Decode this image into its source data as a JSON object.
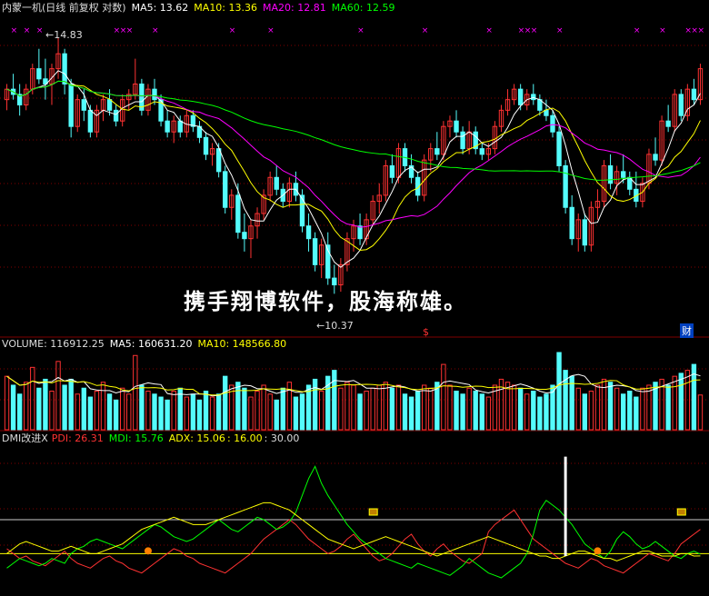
{
  "header": {
    "stock": "内蒙一机(日线 前复权 对数)",
    "ma5": "MA5: 13.62",
    "ma10": "MA10: 13.36",
    "ma20": "MA20: 12.81",
    "ma60": "MA60: 12.59"
  },
  "price_high_label": "14.83",
  "price_low_label": "10.37",
  "overlay_text": "携手翔博软件，股海称雄。",
  "volume_header": {
    "volume": "VOLUME: 116912.25",
    "ma5": "MA5: 160631.20",
    "ma10": "MA10: 148566.80"
  },
  "dmi_header": {
    "name": "DMI改进X",
    "pdi": "PDI: 26.31",
    "mdi": "MDI: 15.76",
    "adx": "ADX: 15.06",
    "level1": ": 16.00",
    "level2": ": 30.00"
  },
  "markers": {
    "dollar": "$",
    "cai": "财"
  },
  "colors": {
    "up": "#ff3232",
    "down": "#54fcfc",
    "ma5": "#ffffff",
    "ma10": "#ffff00",
    "ma20": "#ff00ff",
    "ma60": "#00ff00",
    "grid": "#800000",
    "pdi": "#ff3232",
    "mdi": "#00ff00",
    "adx": "#ffff00"
  },
  "chart_data": [
    {
      "type": "candlestick",
      "title": "内蒙一机(日线 前复权 对数)",
      "price_range": [
        10.0,
        15.2
      ],
      "high_mark": 14.83,
      "low_mark": 10.37,
      "ohlc": [
        [
          13.6,
          13.9,
          13.4,
          13.8
        ],
        [
          13.8,
          14.1,
          13.6,
          13.7
        ],
        [
          13.7,
          13.9,
          13.3,
          13.5
        ],
        [
          13.5,
          13.9,
          13.4,
          13.8
        ],
        [
          13.8,
          14.3,
          13.7,
          14.2
        ],
        [
          14.2,
          14.6,
          13.9,
          14.0
        ],
        [
          14.0,
          14.4,
          13.6,
          13.9
        ],
        [
          13.9,
          14.3,
          13.5,
          14.2
        ],
        [
          14.2,
          14.83,
          14.0,
          14.5
        ],
        [
          14.5,
          14.6,
          13.7,
          13.9
        ],
        [
          13.9,
          14.0,
          12.9,
          13.1
        ],
        [
          13.1,
          13.7,
          13.0,
          13.6
        ],
        [
          13.6,
          13.8,
          13.2,
          13.4
        ],
        [
          13.4,
          13.5,
          12.9,
          13.0
        ],
        [
          13.0,
          13.5,
          12.9,
          13.4
        ],
        [
          13.4,
          13.7,
          13.2,
          13.6
        ],
        [
          13.6,
          13.8,
          13.3,
          13.4
        ],
        [
          13.4,
          13.5,
          13.1,
          13.2
        ],
        [
          13.2,
          13.7,
          13.1,
          13.6
        ],
        [
          13.6,
          13.8,
          13.4,
          13.7
        ],
        [
          13.7,
          14.4,
          13.6,
          13.9
        ],
        [
          13.9,
          14.0,
          13.3,
          13.4
        ],
        [
          13.4,
          13.9,
          13.3,
          13.8
        ],
        [
          13.8,
          14.0,
          13.5,
          13.6
        ],
        [
          13.6,
          13.7,
          13.1,
          13.2
        ],
        [
          13.2,
          13.4,
          12.9,
          13.0
        ],
        [
          13.0,
          13.3,
          12.8,
          13.2
        ],
        [
          13.2,
          13.3,
          12.9,
          13.0
        ],
        [
          13.0,
          13.4,
          12.9,
          13.3
        ],
        [
          13.3,
          13.4,
          13.0,
          13.1
        ],
        [
          13.1,
          13.2,
          12.8,
          12.9
        ],
        [
          12.9,
          13.0,
          12.5,
          12.6
        ],
        [
          12.6,
          12.8,
          12.4,
          12.7
        ],
        [
          12.7,
          12.8,
          12.2,
          12.3
        ],
        [
          12.3,
          12.4,
          11.6,
          11.7
        ],
        [
          11.7,
          12.0,
          11.5,
          11.9
        ],
        [
          11.9,
          12.1,
          11.2,
          11.3
        ],
        [
          11.3,
          11.6,
          11.0,
          11.2
        ],
        [
          11.2,
          11.5,
          10.9,
          11.4
        ],
        [
          11.4,
          11.7,
          11.2,
          11.6
        ],
        [
          11.6,
          12.0,
          11.5,
          11.9
        ],
        [
          11.9,
          12.3,
          11.8,
          12.2
        ],
        [
          12.2,
          12.4,
          11.9,
          12.0
        ],
        [
          12.0,
          12.1,
          11.7,
          11.8
        ],
        [
          11.8,
          12.2,
          11.7,
          12.1
        ],
        [
          12.1,
          12.3,
          11.8,
          11.9
        ],
        [
          11.9,
          12.0,
          11.3,
          11.4
        ],
        [
          11.4,
          11.6,
          11.0,
          11.2
        ],
        [
          11.2,
          11.3,
          10.7,
          10.8
        ],
        [
          10.8,
          11.2,
          10.6,
          11.1
        ],
        [
          11.1,
          11.3,
          10.5,
          10.6
        ],
        [
          10.6,
          10.8,
          10.37,
          10.5
        ],
        [
          10.5,
          10.9,
          10.4,
          10.8
        ],
        [
          10.8,
          11.3,
          10.7,
          11.2
        ],
        [
          11.2,
          11.5,
          11.0,
          11.4
        ],
        [
          11.4,
          11.6,
          11.1,
          11.2
        ],
        [
          11.2,
          11.6,
          11.1,
          11.5
        ],
        [
          11.5,
          11.9,
          11.4,
          11.8
        ],
        [
          11.8,
          12.1,
          11.6,
          11.9
        ],
        [
          11.9,
          12.5,
          11.8,
          12.4
        ],
        [
          12.4,
          12.6,
          12.1,
          12.2
        ],
        [
          12.2,
          12.8,
          12.1,
          12.7
        ],
        [
          12.7,
          12.8,
          12.3,
          12.4
        ],
        [
          12.4,
          12.6,
          12.1,
          12.2
        ],
        [
          12.2,
          12.3,
          11.8,
          11.9
        ],
        [
          11.9,
          12.6,
          11.8,
          12.5
        ],
        [
          12.5,
          12.8,
          12.3,
          12.7
        ],
        [
          12.7,
          13.0,
          12.5,
          12.6
        ],
        [
          12.6,
          13.2,
          12.5,
          13.1
        ],
        [
          13.1,
          13.3,
          12.9,
          13.2
        ],
        [
          13.2,
          13.4,
          12.9,
          13.0
        ],
        [
          13.0,
          13.1,
          12.6,
          12.7
        ],
        [
          12.7,
          13.2,
          12.6,
          13.0
        ],
        [
          13.0,
          13.1,
          12.6,
          12.7
        ],
        [
          12.7,
          12.8,
          12.5,
          12.6
        ],
        [
          12.6,
          12.8,
          12.5,
          12.7
        ],
        [
          12.7,
          13.2,
          12.6,
          13.1
        ],
        [
          13.1,
          13.5,
          13.0,
          13.4
        ],
        [
          13.4,
          13.8,
          13.3,
          13.6
        ],
        [
          13.6,
          13.9,
          13.5,
          13.8
        ],
        [
          13.8,
          13.9,
          13.4,
          13.5
        ],
        [
          13.5,
          13.8,
          13.4,
          13.7
        ],
        [
          13.7,
          13.9,
          13.5,
          13.6
        ],
        [
          13.6,
          13.7,
          13.3,
          13.4
        ],
        [
          13.4,
          13.6,
          13.2,
          13.3
        ],
        [
          13.3,
          13.4,
          12.9,
          13.0
        ],
        [
          13.0,
          13.1,
          12.3,
          12.4
        ],
        [
          12.4,
          12.5,
          11.6,
          11.7
        ],
        [
          11.7,
          11.9,
          11.1,
          11.2
        ],
        [
          11.2,
          11.6,
          11.0,
          11.5
        ],
        [
          11.5,
          11.6,
          11.0,
          11.1
        ],
        [
          11.1,
          11.8,
          11.0,
          11.7
        ],
        [
          11.7,
          12.0,
          11.5,
          11.8
        ],
        [
          11.8,
          12.5,
          11.7,
          12.4
        ],
        [
          12.4,
          12.6,
          12.0,
          12.1
        ],
        [
          12.1,
          12.4,
          11.9,
          12.3
        ],
        [
          12.3,
          12.6,
          12.1,
          12.2
        ],
        [
          12.2,
          12.3,
          11.9,
          12.0
        ],
        [
          12.0,
          12.3,
          11.7,
          11.8
        ],
        [
          11.8,
          12.2,
          11.7,
          12.1
        ],
        [
          12.1,
          12.7,
          12.0,
          12.6
        ],
        [
          12.6,
          12.9,
          12.4,
          12.5
        ],
        [
          12.5,
          13.3,
          12.4,
          13.2
        ],
        [
          13.2,
          13.5,
          13.0,
          13.1
        ],
        [
          13.1,
          13.8,
          13.0,
          13.7
        ],
        [
          13.7,
          13.8,
          13.2,
          13.3
        ],
        [
          13.3,
          13.9,
          13.2,
          13.8
        ],
        [
          13.8,
          14.0,
          13.5,
          13.6
        ],
        [
          13.6,
          14.3,
          13.5,
          14.2
        ]
      ],
      "series": [
        {
          "name": "MA5",
          "value": 13.62
        },
        {
          "name": "MA10",
          "value": 13.36
        },
        {
          "name": "MA20",
          "value": 12.81
        },
        {
          "name": "MA60",
          "value": 12.59
        }
      ]
    },
    {
      "type": "bar",
      "title": "VOLUME",
      "value_label": 116912.25,
      "ma5": 160631.2,
      "ma10": 148566.8,
      "ylim": [
        0,
        260000
      ],
      "values": [
        180000,
        150000,
        120000,
        160000,
        210000,
        140000,
        170000,
        130000,
        230000,
        150000,
        170000,
        120000,
        140000,
        110000,
        130000,
        160000,
        120000,
        100000,
        140000,
        120000,
        250000,
        150000,
        130000,
        120000,
        110000,
        100000,
        130000,
        140000,
        110000,
        120000,
        100000,
        130000,
        110000,
        120000,
        180000,
        150000,
        160000,
        140000,
        110000,
        130000,
        150000,
        120000,
        100000,
        140000,
        160000,
        110000,
        120000,
        150000,
        170000,
        130000,
        180000,
        200000,
        140000,
        160000,
        150000,
        120000,
        130000,
        140000,
        150000,
        160000,
        140000,
        150000,
        120000,
        110000,
        130000,
        150000,
        140000,
        160000,
        220000,
        150000,
        130000,
        120000,
        140000,
        130000,
        120000,
        110000,
        150000,
        170000,
        160000,
        150000,
        140000,
        120000,
        130000,
        110000,
        120000,
        150000,
        260000,
        200000,
        180000,
        140000,
        120000,
        130000,
        150000,
        170000,
        160000,
        140000,
        120000,
        130000,
        110000,
        140000,
        150000,
        160000,
        170000,
        150000,
        180000,
        190000,
        200000,
        220000,
        116912
      ]
    },
    {
      "type": "line",
      "title": "DMI改进X",
      "ylim": [
        0,
        60
      ],
      "levels": [
        16,
        30
      ],
      "series": [
        {
          "name": "PDI",
          "last": 26.31,
          "values": [
            18,
            16,
            14,
            15,
            13,
            12,
            11,
            13,
            15,
            17,
            14,
            12,
            11,
            10,
            12,
            14,
            15,
            13,
            12,
            10,
            9,
            8,
            10,
            12,
            14,
            16,
            18,
            17,
            15,
            14,
            12,
            11,
            10,
            9,
            8,
            10,
            12,
            14,
            16,
            19,
            22,
            24,
            26,
            28,
            30,
            28,
            25,
            22,
            20,
            18,
            16,
            17,
            19,
            22,
            24,
            21,
            18,
            15,
            13,
            14,
            16,
            19,
            22,
            24,
            20,
            17,
            15,
            18,
            20,
            17,
            15,
            13,
            12,
            14,
            16,
            25,
            28,
            30,
            32,
            34,
            30,
            26,
            22,
            20,
            18,
            16,
            14,
            12,
            11,
            10,
            12,
            14,
            13,
            11,
            10,
            9,
            8,
            10,
            12,
            14,
            16,
            15,
            14,
            13,
            16,
            20,
            22,
            24,
            26
          ]
        },
        {
          "name": "MDI",
          "last": 15.76,
          "values": [
            10,
            12,
            14,
            13,
            12,
            11,
            12,
            14,
            13,
            12,
            16,
            18,
            19,
            21,
            22,
            21,
            20,
            19,
            18,
            20,
            22,
            24,
            26,
            28,
            27,
            25,
            23,
            22,
            21,
            22,
            24,
            26,
            28,
            30,
            28,
            26,
            25,
            27,
            29,
            31,
            30,
            28,
            26,
            27,
            29,
            33,
            40,
            47,
            52,
            45,
            40,
            36,
            32,
            28,
            25,
            22,
            20,
            18,
            16,
            14,
            13,
            12,
            11,
            10,
            12,
            11,
            10,
            9,
            8,
            7,
            9,
            11,
            14,
            12,
            10,
            8,
            7,
            6,
            8,
            10,
            12,
            16,
            24,
            34,
            38,
            36,
            34,
            31,
            28,
            24,
            20,
            18,
            16,
            14,
            17,
            22,
            25,
            23,
            20,
            18,
            19,
            21,
            19,
            17,
            15,
            14,
            16,
            17,
            15.76
          ]
        },
        {
          "name": "ADX",
          "last": 15.06,
          "values": [
            16,
            18,
            20,
            21,
            20,
            19,
            18,
            17,
            17,
            18,
            19,
            18,
            17,
            16,
            16,
            17,
            18,
            19,
            20,
            22,
            24,
            26,
            27,
            28,
            29,
            30,
            31,
            30,
            29,
            28,
            28,
            28,
            29,
            30,
            31,
            32,
            33,
            34,
            35,
            36,
            37,
            37,
            36,
            35,
            34,
            32,
            30,
            28,
            26,
            24,
            22,
            21,
            20,
            19,
            18,
            19,
            20,
            21,
            22,
            23,
            22,
            21,
            20,
            19,
            18,
            17,
            16,
            15,
            16,
            17,
            18,
            19,
            20,
            21,
            22,
            23,
            22,
            21,
            20,
            19,
            18,
            17,
            16,
            15,
            15,
            14,
            14,
            15,
            16,
            17,
            17,
            16,
            15,
            14,
            14,
            13,
            14,
            15,
            16,
            17,
            17,
            16,
            15,
            15,
            15,
            16,
            16,
            15,
            15.06
          ]
        }
      ]
    }
  ]
}
